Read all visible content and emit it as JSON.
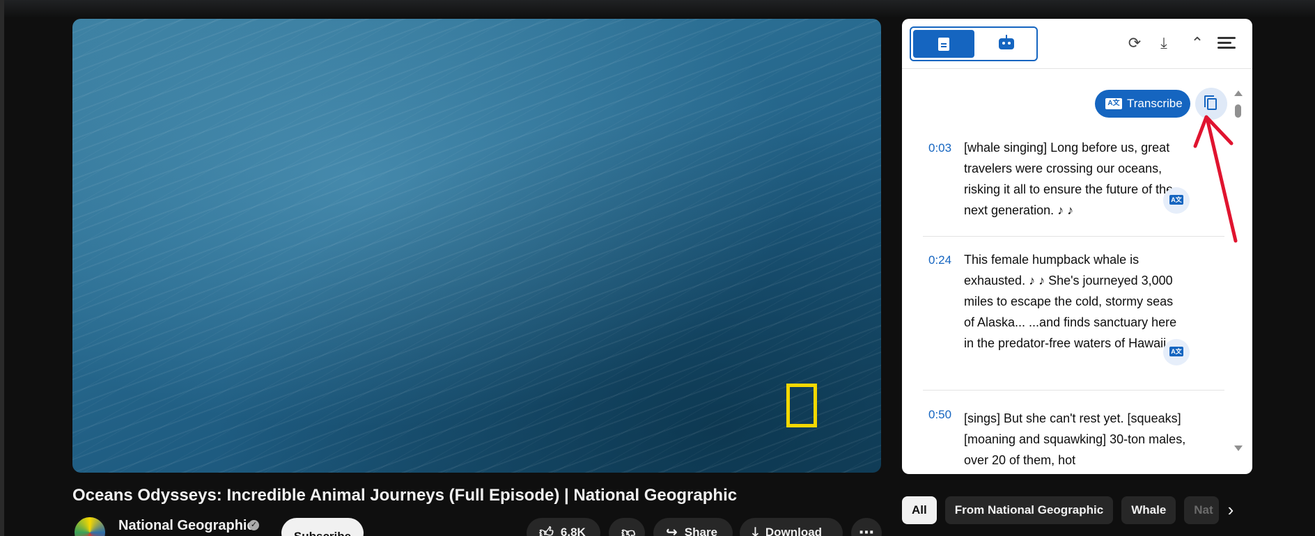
{
  "video": {
    "title": "Oceans Odysseys: Incredible Animal Journeys (Full Episode) | National Geographic"
  },
  "channel": {
    "name": "National Geographic",
    "verified_icon": "verified-check-icon",
    "subscribe_label": "Subscribe"
  },
  "actions": {
    "like_count": "6.8K",
    "share_label": "Share",
    "download_label": "Download",
    "more_label": "⋯"
  },
  "transcript_panel": {
    "modes": [
      "document-icon",
      "robot-icon"
    ],
    "header_icons": [
      "sync-icon",
      "download-icon",
      "collapse-icon",
      "menu-icon"
    ],
    "transcribe_label": "Transcribe",
    "segments": [
      {
        "time": "0:03",
        "text": "[whale singing] Long before us, great travelers were crossing our oceans, risking it all to ensure the future of the next generation. ♪ ♪"
      },
      {
        "time": "0:24",
        "text": "This female humpback whale is exhausted. ♪ ♪ She's journeyed 3,000 miles to escape the cold, stormy seas of Alaska... ...and finds sanctuary here in the predator-free waters of Hawaii."
      },
      {
        "time": "0:50",
        "text": "[sings] But she can't rest yet. [squeaks] [moaning and squawking] 30-ton males, over 20 of them, hot"
      }
    ]
  },
  "chips": {
    "items": [
      "All",
      "From National Geographic",
      "Whale",
      "Nat"
    ],
    "next_icon": "chevron-right-icon"
  },
  "colors": {
    "accent": "#1565c0",
    "annotation_arrow": "#e0142f",
    "logo_yellow": "#f6d800"
  }
}
